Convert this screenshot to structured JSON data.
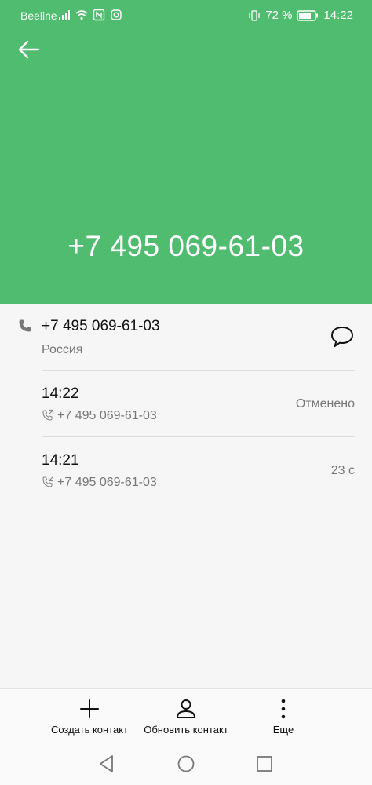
{
  "status_bar": {
    "carrier": "Beeline",
    "battery": "72 %",
    "time": "14:22"
  },
  "header": {
    "number": "+7 495 069-61-03",
    "back_icon": "arrow-left-icon",
    "bg_color": "#50bc6f"
  },
  "contact": {
    "number": "+7 495 069-61-03",
    "region": "Россия",
    "message_icon": "chat-bubble-icon"
  },
  "calls": [
    {
      "time": "14:22",
      "number": "+7 495 069-61-03",
      "status": "Отменено",
      "icon": "outgoing-call-icon"
    },
    {
      "time": "14:21",
      "number": "+7 495 069-61-03",
      "status": "23 с",
      "icon": "incoming-call-icon"
    }
  ],
  "bottom_bar": {
    "create_contact": "Создать контакт",
    "update_contact": "Обновить контакт",
    "more": "Еще"
  }
}
